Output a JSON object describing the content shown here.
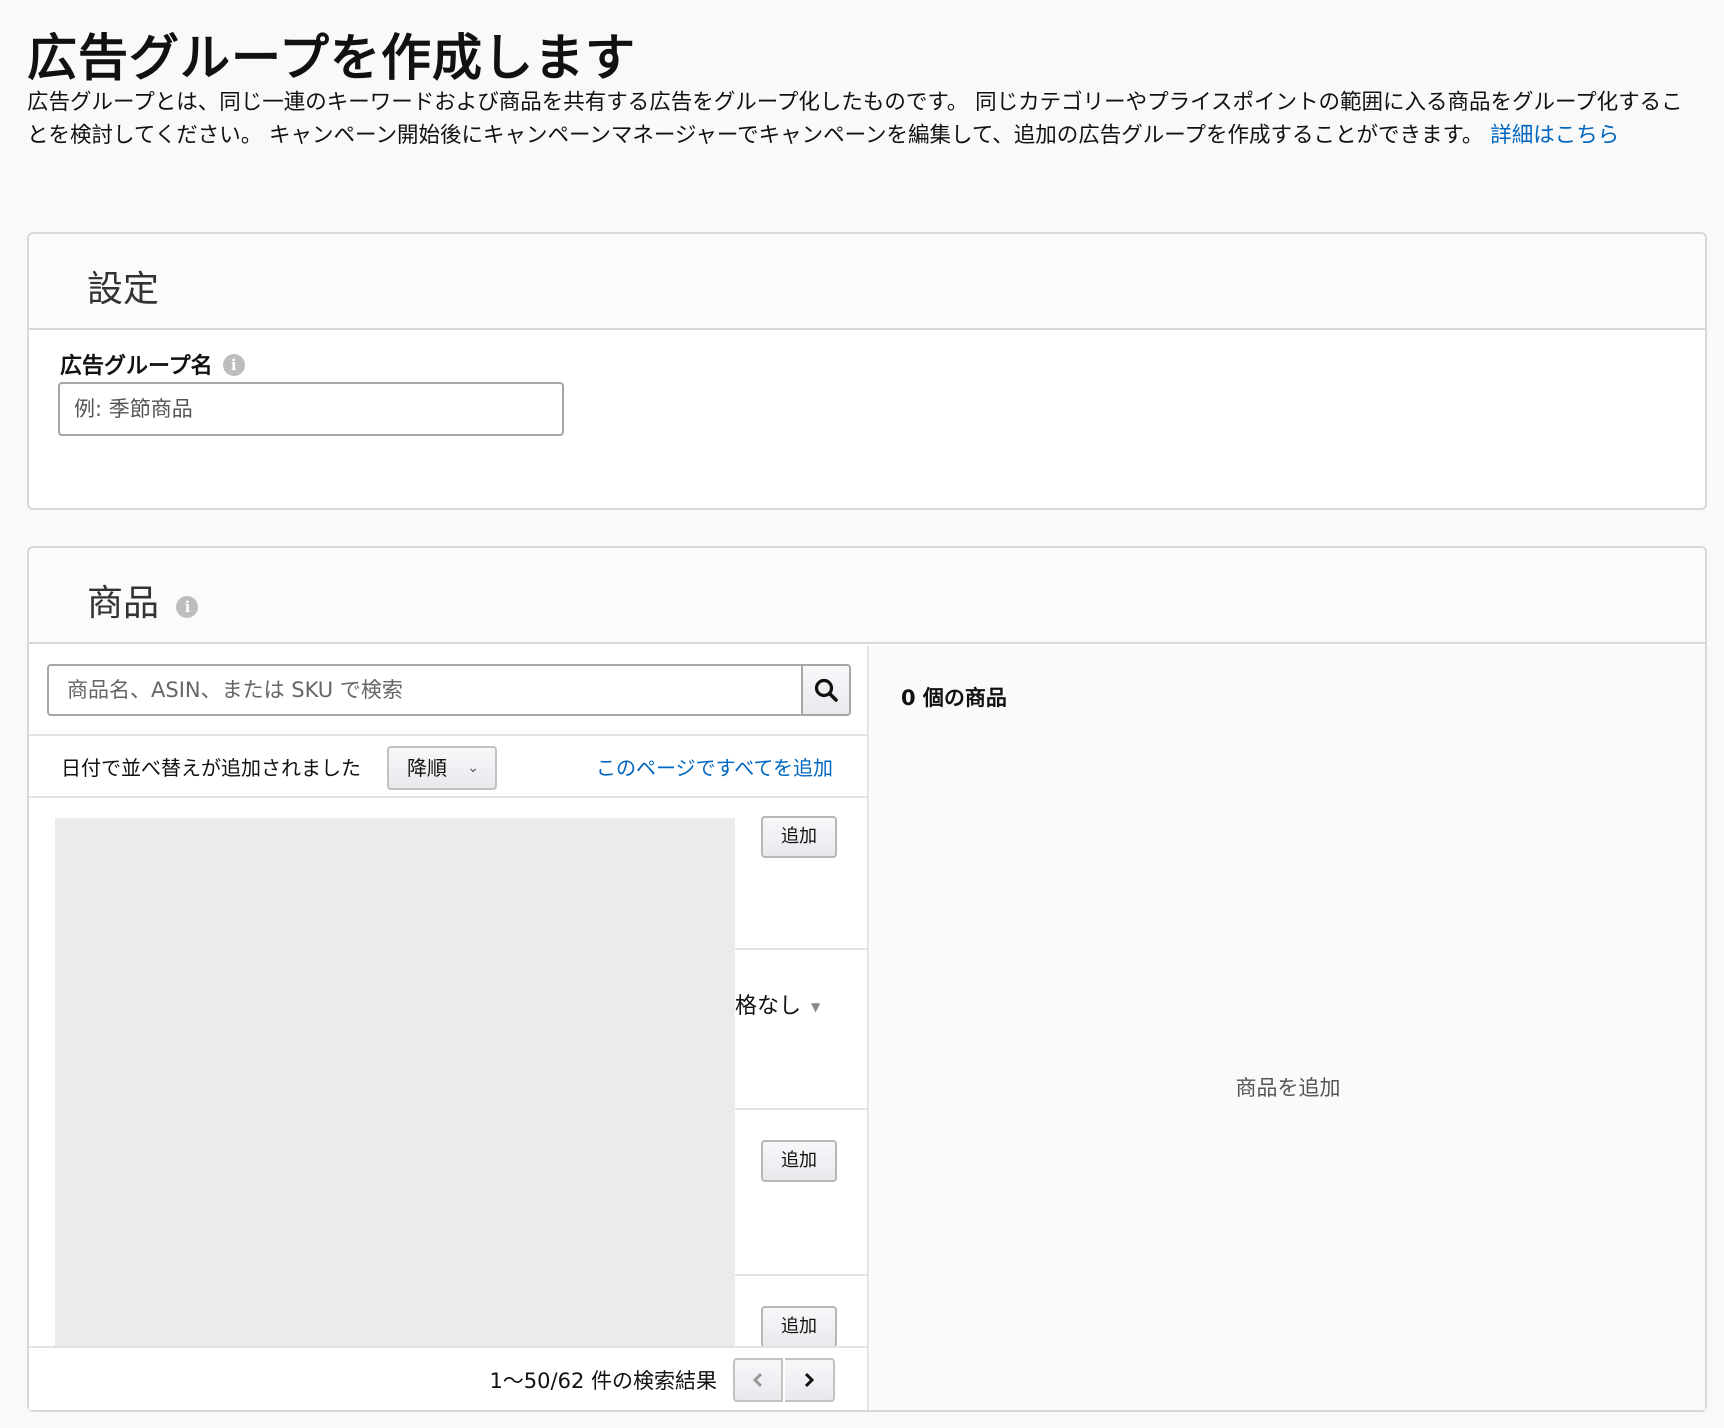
{
  "page": {
    "title": "広告グループを作成します",
    "intro_text": "広告グループとは、同じ一連のキーワードおよび商品を共有する広告をグループ化したものです。 同じカテゴリーやプライスポイントの範囲に入る商品をグループ化することを検討してください。 キャンペーン開始後にキャンペーンマネージャーでキャンペーンを編集して、追加の広告グループを作成することができます。 ",
    "learn_more_link": "詳細はこちら"
  },
  "settings": {
    "section_title": "設定",
    "ad_group_name_label": "広告グループ名",
    "ad_group_name_placeholder": "例: 季節商品",
    "ad_group_name_value": ""
  },
  "products": {
    "section_title": "商品",
    "search_placeholder": "商品名、ASIN、または SKU で検索",
    "sort_label": "日付で並べ替えが追加されました",
    "sort_selected": "降順",
    "add_all_link": "このページですべてを追加",
    "add_button_label": "追加",
    "price_text": "格なし",
    "pagination_text": "1〜50/62 件の検索結果"
  },
  "selected_products": {
    "count_label": "0 個の商品",
    "empty_text": "商品を追加"
  },
  "icons": {
    "info": "info-icon",
    "search": "search-icon",
    "chevron_down": "chevron-down-icon",
    "chevron_left": "chevron-left-icon",
    "chevron_right": "chevron-right-icon"
  },
  "colors": {
    "link": "#0066c0",
    "border": "#d5d9d9",
    "placeholder_block": "#ebebeb"
  }
}
